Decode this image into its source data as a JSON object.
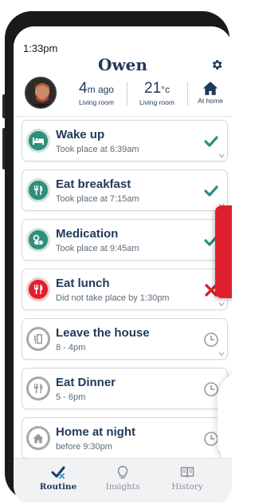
{
  "status_bar": {
    "time": "1:33pm"
  },
  "header": {
    "user_name": "Owen",
    "stats": [
      {
        "value": "4",
        "unit": "m ago",
        "label": "Living room"
      },
      {
        "value": "21",
        "unit": "°c",
        "label": "Living room"
      },
      {
        "value": "",
        "unit": "",
        "label": "At home"
      }
    ]
  },
  "routines": [
    {
      "title": "Wake up",
      "subtitle": "Took place at 6:39am",
      "status": "done",
      "icon": "bed-icon"
    },
    {
      "title": "Eat breakfast",
      "subtitle": "Took place at 7:15am",
      "status": "done",
      "icon": "cutlery-icon"
    },
    {
      "title": "Medication",
      "subtitle": "Took place at 9:45am",
      "status": "done",
      "icon": "medication-icon"
    },
    {
      "title": "Eat lunch",
      "subtitle": "Did not take place by 1:30pm",
      "status": "missed",
      "icon": "cutlery-icon"
    },
    {
      "title": "Leave the house",
      "subtitle": "8 - 4pm",
      "status": "pending",
      "icon": "exit-door-icon"
    },
    {
      "title": "Eat Dinner",
      "subtitle": "5 - 6pm",
      "status": "pending",
      "icon": "cutlery-icon"
    },
    {
      "title": "Home at night",
      "subtitle": "before 9:30pm",
      "status": "pending",
      "icon": "home-icon"
    }
  ],
  "nav": {
    "items": [
      {
        "label": "Routine",
        "icon": "routine-check-icon",
        "active": true
      },
      {
        "label": "Insights",
        "icon": "lightbulb-icon",
        "active": false
      },
      {
        "label": "History",
        "icon": "book-icon",
        "active": false
      }
    ]
  },
  "colors": {
    "primary_text": "#1f3a5a",
    "done_green": "#2f8f7a",
    "missed_red": "#e0202e",
    "pending_grey": "#a8a8a8"
  }
}
